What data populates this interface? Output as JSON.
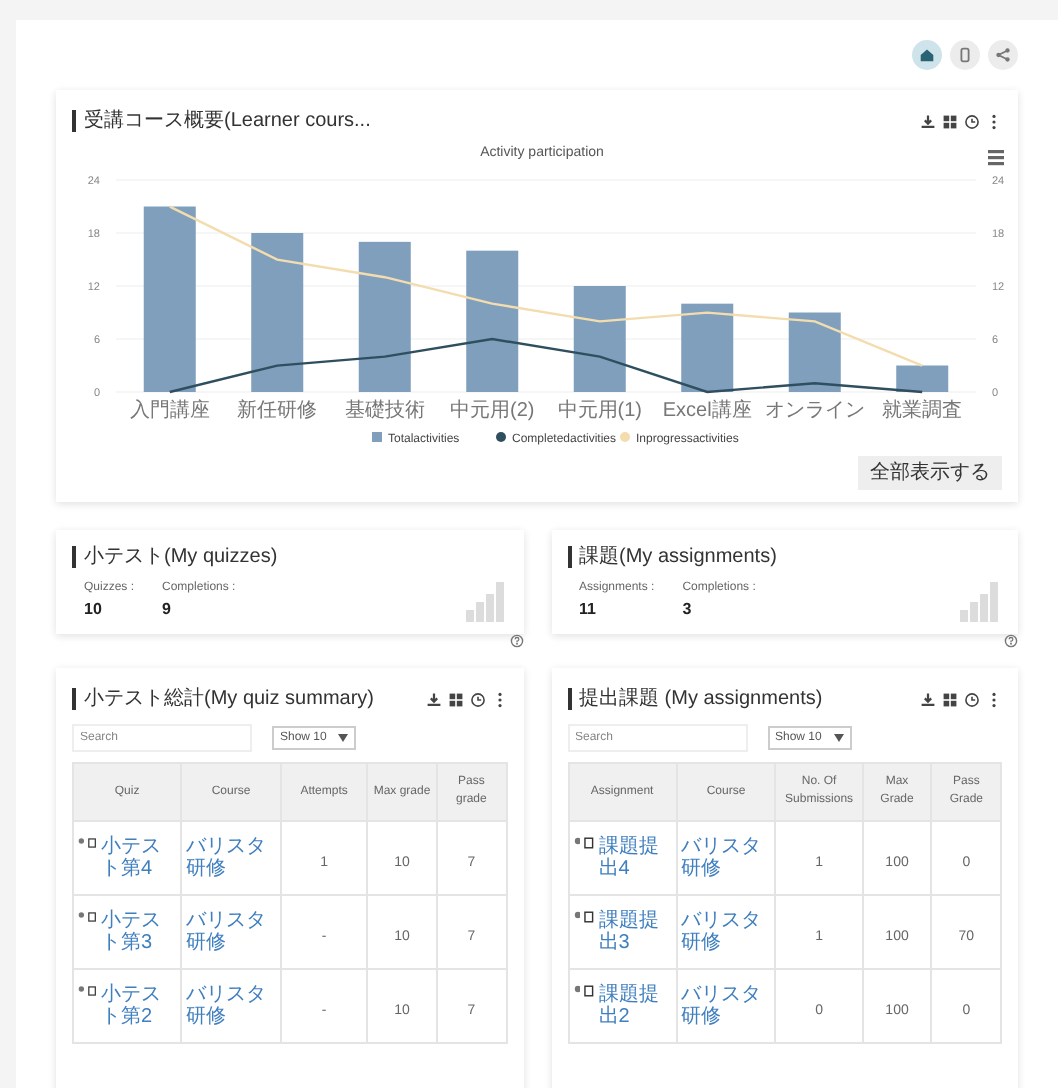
{
  "toolbar": {
    "buttons": [
      {
        "kind": "home",
        "selected": true
      },
      {
        "kind": "page",
        "selected": false
      },
      {
        "kind": "share",
        "selected": false
      }
    ]
  },
  "course_overview": {
    "title": "受講コース概要(Learner cours...",
    "chart_data": {
      "type": "bar",
      "title": "Activity participation",
      "categories": [
        "入門講座",
        "新任研修",
        "基礎技術",
        "中元用(2)",
        "中元用(1)",
        "Excel講座",
        "オンライン",
        "就業調査"
      ],
      "series": [
        {
          "name": "Totalactivities",
          "type": "bar",
          "color": "#7f9fbd",
          "values": [
            21,
            18,
            17,
            16,
            12,
            10,
            9,
            3
          ]
        },
        {
          "name": "Completedactivities",
          "type": "line",
          "color": "#2f4f5f",
          "values": [
            0,
            3,
            4,
            6,
            4,
            0,
            1,
            0
          ]
        },
        {
          "name": "Inprogressactivities",
          "type": "line",
          "color": "#f3dcae",
          "values": [
            21,
            15,
            13,
            10,
            8,
            9,
            8,
            3
          ]
        }
      ],
      "ylim": [
        0,
        24
      ],
      "yticks": [
        0,
        6,
        12,
        18,
        24
      ],
      "y2lim": [
        0,
        24
      ],
      "y2ticks": [
        0,
        6,
        12,
        18,
        24
      ],
      "grid": true,
      "legend": "bottom"
    },
    "button": "全部表示する"
  },
  "summary_cards": [
    {
      "title": "小テスト(My quizzes)",
      "stats": [
        {
          "label": "Quizzes :",
          "value": "10"
        },
        {
          "label": "Completions :",
          "value": "9"
        }
      ]
    },
    {
      "title": "課題(My assignments)",
      "stats": [
        {
          "label": "Assignments :",
          "value": "11"
        },
        {
          "label": "Completions :",
          "value": "3"
        }
      ]
    }
  ],
  "tables": [
    {
      "title": "小テスト総計(My quiz summary)",
      "search": {
        "placeholder": "Search"
      },
      "page_size": "Show 10",
      "columns": [
        "Quiz",
        "Course",
        "Attempts",
        "Max grade",
        "Pass grade"
      ],
      "rows": [
        {
          "cells": [
            "小テスト第4",
            "バリスタ研修",
            "1",
            "10",
            "7"
          ]
        },
        {
          "cells": [
            "小テスト第3",
            "バリスタ研修",
            "-",
            "10",
            "7"
          ]
        },
        {
          "cells": [
            "小テスト第2",
            "バリスタ研修",
            "-",
            "10",
            "7"
          ]
        }
      ]
    },
    {
      "title": "提出課題 (My assignments)",
      "search": {
        "placeholder": "Search"
      },
      "page_size": "Show 10",
      "columns": [
        "Assignment",
        "Course",
        "No. Of Submissions",
        "Max Grade",
        "Pass Grade"
      ],
      "rows": [
        {
          "cells": [
            "課題提出4",
            "バリスタ研修",
            "1",
            "100",
            "0"
          ]
        },
        {
          "cells": [
            "課題提出3",
            "バリスタ研修",
            "1",
            "100",
            "70"
          ]
        },
        {
          "cells": [
            "課題提出2",
            "バリスタ研修",
            "0",
            "100",
            "0"
          ]
        }
      ]
    }
  ]
}
